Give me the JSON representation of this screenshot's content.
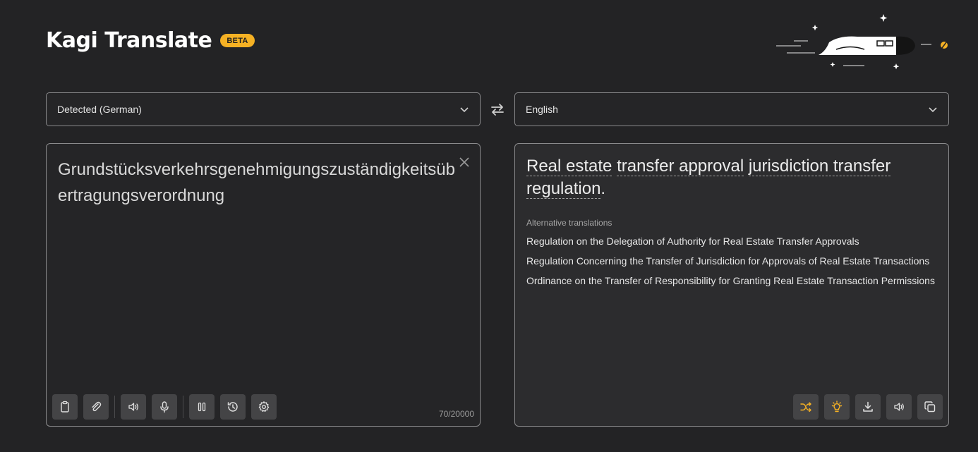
{
  "app": {
    "title": "Kagi Translate",
    "badge": "BETA"
  },
  "colors": {
    "accent": "#f5b124",
    "background": "#232325",
    "border": "#8a8a8c"
  },
  "source_language": {
    "value": "Detected (German)"
  },
  "target_language": {
    "value": "English"
  },
  "source": {
    "text": "Grundstücksverkehrsgenehmigungszuständigkeitsübertragungsverordnung",
    "char_count": "70/20000"
  },
  "result": {
    "segments": [
      {
        "text": "Real estate",
        "underlined": true
      },
      {
        "text": " ",
        "underlined": false
      },
      {
        "text": "transfer approval",
        "underlined": true
      },
      {
        "text": " ",
        "underlined": false
      },
      {
        "text": "jurisdiction transfer regulation",
        "underlined": true
      },
      {
        "text": ".",
        "underlined": false
      }
    ],
    "alternatives_title": "Alternative translations",
    "alternatives": [
      "Regulation on the Delegation of Authority for Real Estate Transfer Approvals",
      "Regulation Concerning the Transfer of Jurisdiction for Approvals of Real Estate Transactions",
      "Ordinance on the Transfer of Responsibility for Granting Real Estate Transaction Permissions"
    ]
  },
  "toolbar_left": [
    {
      "name": "paste-button",
      "icon": "clipboard-icon"
    },
    {
      "name": "attach-button",
      "icon": "paperclip-icon"
    },
    {
      "name": "speak-source-button",
      "icon": "speaker-icon"
    },
    {
      "name": "microphone-button",
      "icon": "microphone-icon"
    },
    {
      "name": "pause-button",
      "icon": "pause-icon"
    },
    {
      "name": "history-button",
      "icon": "history-icon"
    },
    {
      "name": "settings-button",
      "icon": "gear-icon"
    }
  ],
  "toolbar_right": [
    {
      "name": "shuffle-button",
      "icon": "shuffle-icon"
    },
    {
      "name": "explain-button",
      "icon": "lightbulb-icon"
    },
    {
      "name": "download-button",
      "icon": "download-icon"
    },
    {
      "name": "speak-translation-button",
      "icon": "speaker-icon"
    },
    {
      "name": "copy-button",
      "icon": "copy-icon"
    }
  ]
}
